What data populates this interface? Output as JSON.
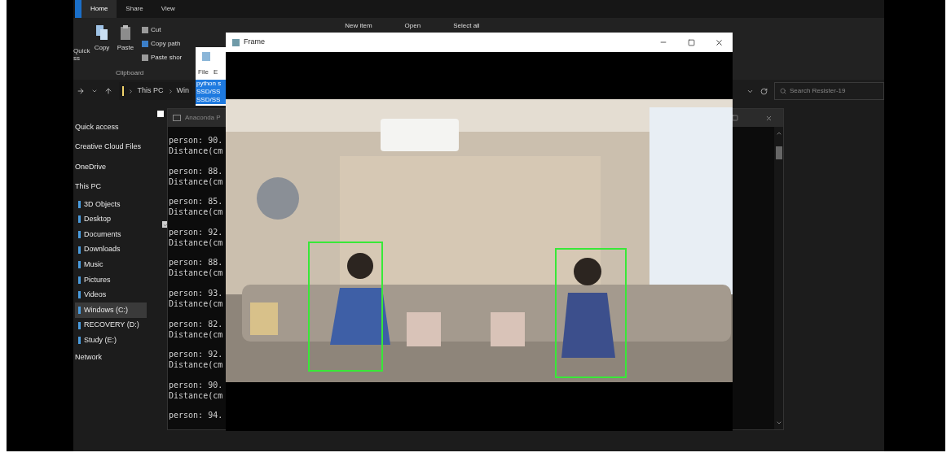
{
  "explorer": {
    "ribbon_tabs": [
      {
        "label": "Home",
        "selected": true
      },
      {
        "label": "Share",
        "selected": false
      },
      {
        "label": "View",
        "selected": false
      }
    ],
    "quick_access": [
      "Quick",
      "ss"
    ],
    "clipboard_buttons": [
      {
        "label": "Copy",
        "kind": "large"
      },
      {
        "label": "Paste",
        "kind": "large"
      },
      {
        "label": "Cut",
        "kind": "small"
      },
      {
        "label": "Copy path",
        "kind": "small"
      },
      {
        "label": "Paste shor",
        "kind": "small"
      }
    ],
    "clipboard_group": "Clipboard",
    "ribbon_more": [
      "New item",
      "Open",
      "Select all"
    ],
    "breadcrumb": [
      "This PC",
      "Win"
    ],
    "search": {
      "placeholder": "Search Resister-19"
    },
    "nav_items": [
      {
        "label": "Quick access",
        "selected": false
      },
      {
        "label": "Creative Cloud Files",
        "selected": false
      },
      {
        "label": "OneDrive",
        "selected": false
      },
      {
        "label": "This PC",
        "selected": false,
        "children": [
          {
            "label": "3D Objects",
            "selected": false
          },
          {
            "label": "Desktop",
            "selected": false
          },
          {
            "label": "Documents",
            "selected": false
          },
          {
            "label": "Downloads",
            "selected": false
          },
          {
            "label": "Music",
            "selected": false
          },
          {
            "label": "Pictures",
            "selected": false
          },
          {
            "label": "Videos",
            "selected": false
          },
          {
            "label": "Windows (C:)",
            "selected": true
          },
          {
            "label": "RECOVERY (D:)",
            "selected": false
          },
          {
            "label": "Study (E:)",
            "selected": false
          }
        ]
      },
      {
        "label": "Network",
        "selected": false
      }
    ],
    "item_checkboxes": [
      {
        "checked": false
      },
      {
        "checked": true
      }
    ]
  },
  "notepad": {
    "menu": [
      "File",
      "E"
    ],
    "lines": [
      "python s",
      "SSD/SS",
      "SSD/SS"
    ]
  },
  "console": {
    "title": "Anaconda P",
    "groups": [
      [
        "person: 90.",
        "Distance(cm"
      ],
      [
        "person: 88.",
        "Distance(cm"
      ],
      [
        "person: 85.",
        "Distance(cm"
      ],
      [
        "person: 92.",
        "Distance(cm"
      ],
      [
        "person: 88.",
        "Distance(cm"
      ],
      [
        "person: 93.",
        "Distance(cm"
      ],
      [
        "person: 82.",
        "Distance(cm"
      ],
      [
        "person: 92.",
        "Distance(cm"
      ],
      [
        "person: 90.",
        "Distance(cm"
      ],
      [
        "person: 94."
      ]
    ]
  },
  "frame": {
    "title": "Frame"
  }
}
